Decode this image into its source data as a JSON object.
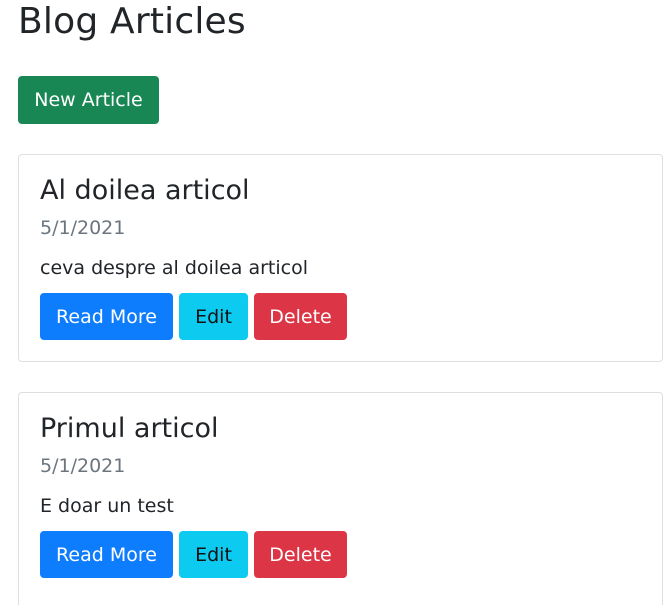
{
  "page": {
    "title": "Blog Articles",
    "new_article_label": "New Article"
  },
  "articles": [
    {
      "title": "Al doilea articol",
      "date": "5/1/2021",
      "summary": "ceva despre al doilea articol",
      "read_more_label": "Read More",
      "edit_label": "Edit",
      "delete_label": "Delete"
    },
    {
      "title": "Primul articol",
      "date": "5/1/2021",
      "summary": "E doar un test",
      "read_more_label": "Read More",
      "edit_label": "Edit",
      "delete_label": "Delete"
    }
  ],
  "colors": {
    "new_article": "#198754",
    "read_more": "#0d7dfd",
    "edit": "#0dcaf0",
    "delete": "#dc3545",
    "muted_text": "#6c757d"
  }
}
